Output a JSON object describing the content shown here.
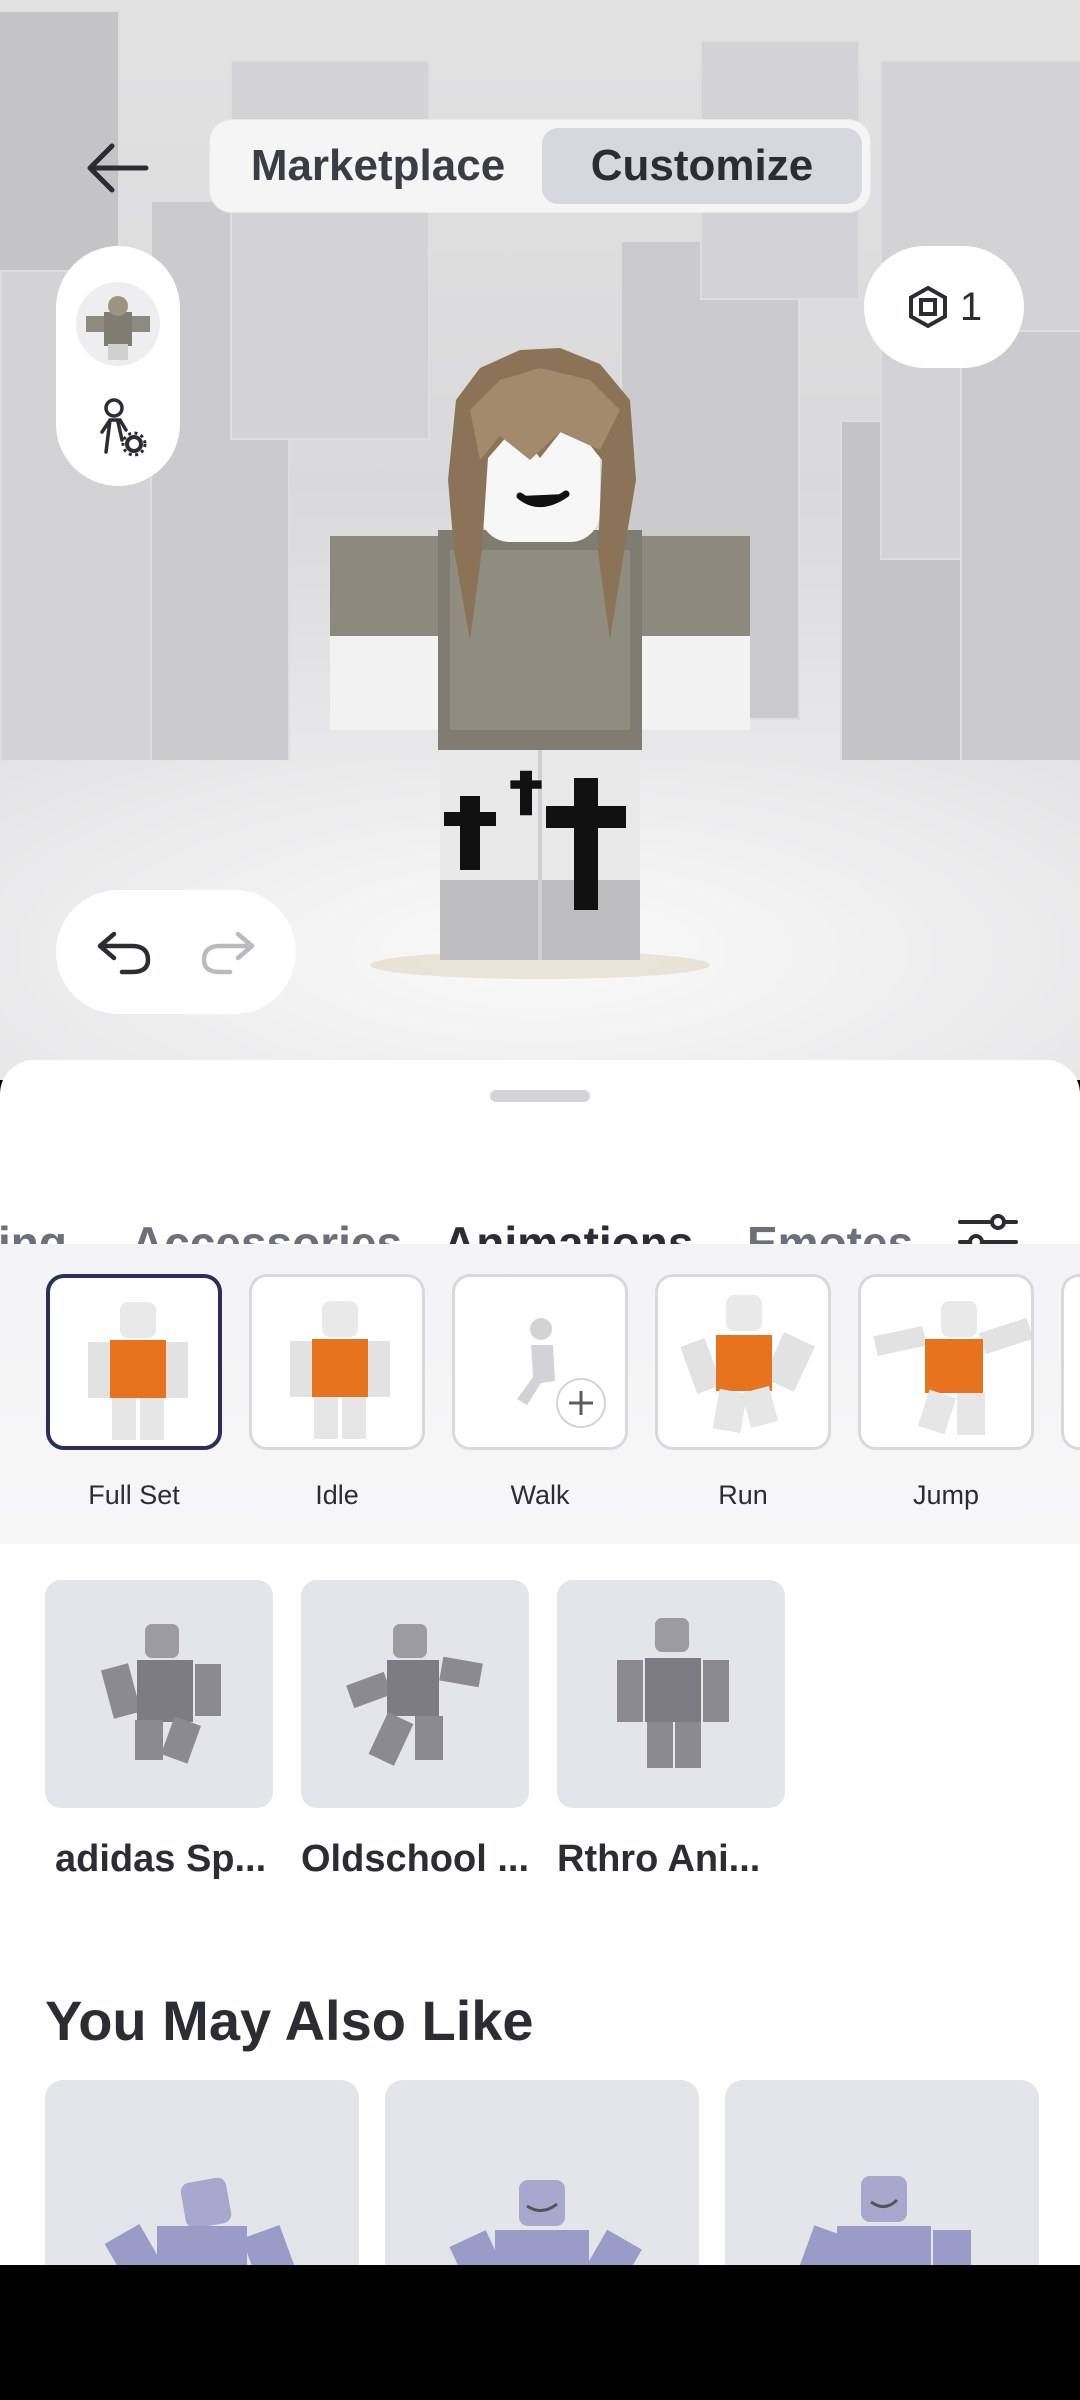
{
  "header": {
    "segments": [
      {
        "label": "Marketplace",
        "active": false
      },
      {
        "label": "Customize",
        "active": true
      }
    ]
  },
  "robux": {
    "count": "1"
  },
  "sheet": {
    "tabs": [
      {
        "label": "ing"
      },
      {
        "label": "Accessories"
      },
      {
        "label": "Animations",
        "active": true
      },
      {
        "label": "Emotes"
      }
    ],
    "slots": [
      {
        "label": "Full Set",
        "selected": true
      },
      {
        "label": "Idle"
      },
      {
        "label": "Walk",
        "empty": true
      },
      {
        "label": "Run"
      },
      {
        "label": "Jump"
      }
    ],
    "packs": [
      {
        "title": "adidas Sp..."
      },
      {
        "title": "Oldschool ..."
      },
      {
        "title": "Rthro Ani..."
      }
    ],
    "section_title": "You May Also Like"
  },
  "colors": {
    "accent_dark": "#2b2d33",
    "selected_border": "#2b2d5a",
    "shirt_orange": "#e8731e",
    "card_bg": "#e4e5e9"
  }
}
